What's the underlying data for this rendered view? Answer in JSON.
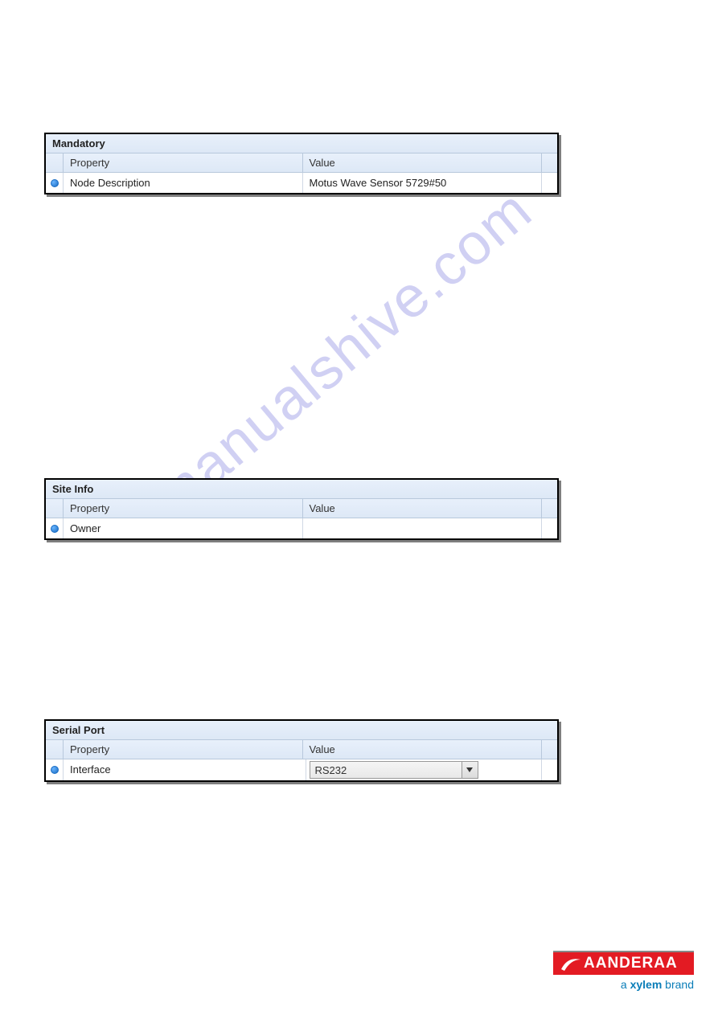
{
  "watermark": "manualshive.com",
  "panels": [
    {
      "title": "Mandatory",
      "headers": {
        "property": "Property",
        "value": "Value"
      },
      "row": {
        "property": "Node Description",
        "value": "Motus Wave Sensor 5729#50"
      }
    },
    {
      "title": "Site Info",
      "headers": {
        "property": "Property",
        "value": "Value"
      },
      "row": {
        "property": "Owner",
        "value": ""
      }
    },
    {
      "title": "Serial Port",
      "headers": {
        "property": "Property",
        "value": "Value"
      },
      "row": {
        "property": "Interface",
        "dropdown": "RS232"
      }
    }
  ],
  "footer": {
    "logo": "AANDERAA",
    "tagline_prefix": "a ",
    "tagline_brand": "xylem",
    "tagline_suffix": " brand"
  }
}
